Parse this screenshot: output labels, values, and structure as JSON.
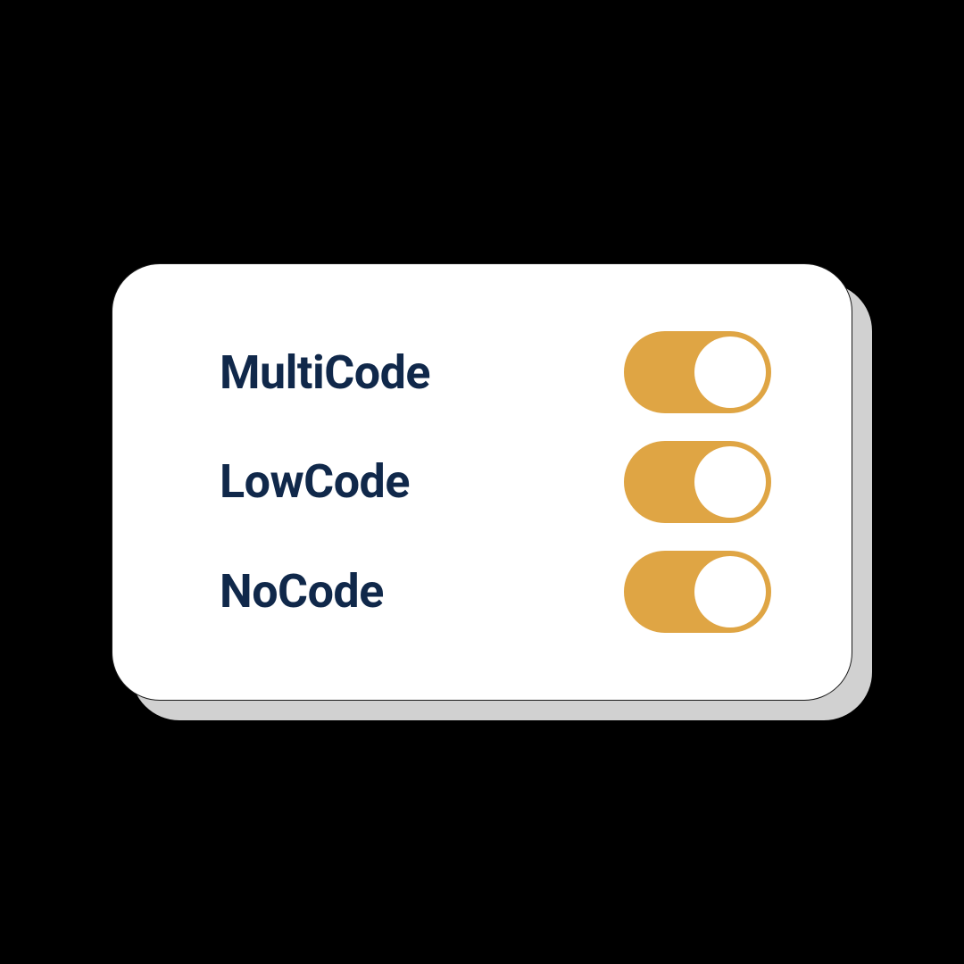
{
  "card": {
    "toggles": [
      {
        "label": "MultiCode",
        "state": "on"
      },
      {
        "label": "LowCode",
        "state": "on"
      },
      {
        "label": "NoCode",
        "state": "on"
      }
    ]
  },
  "colors": {
    "background": "#000000",
    "cardBg": "#ffffff",
    "shadow": "#d1d1d1",
    "label": "#10284a",
    "toggleOn": "#dfa544"
  }
}
